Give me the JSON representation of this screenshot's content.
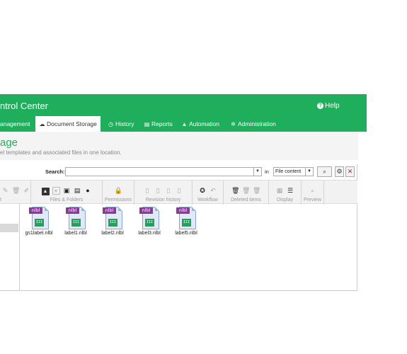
{
  "header": {
    "app_title": "ntrol Center",
    "help_label": "Help",
    "tabs": [
      {
        "label": "anagement",
        "icon": ""
      },
      {
        "label": "Document Storage",
        "icon": "cloud-icon"
      },
      {
        "label": "History",
        "icon": "clock-icon"
      },
      {
        "label": "Reports",
        "icon": "chart-icon"
      },
      {
        "label": "Automation",
        "icon": "robot-icon"
      },
      {
        "label": "Administration",
        "icon": "gears-icon"
      }
    ],
    "active_tab": "Document Storage"
  },
  "subheader": {
    "title": "age",
    "description": "el templates and associated files in one location."
  },
  "search": {
    "label": "Search:",
    "value": "",
    "in_label": "in",
    "scope": "File content"
  },
  "toolbar": {
    "groups": [
      {
        "label": "t",
        "icons": [
          "edit-icon",
          "delete-icon",
          "rename-icon"
        ]
      },
      {
        "label": "Files & Folders",
        "icons": [
          "upload-icon",
          "download-icon",
          "new-folder-icon",
          "new-file-icon",
          "info-icon"
        ]
      },
      {
        "label": "Permissions",
        "icons": [
          "lock-icon"
        ]
      },
      {
        "label": "Revision history",
        "icons": [
          "checkout-icon",
          "checkin-icon",
          "undo-checkout-icon",
          "history-icon"
        ]
      },
      {
        "label": "Workflow",
        "icons": [
          "workflow-icon",
          "workflow-undo-icon"
        ]
      },
      {
        "label": "Deleted items",
        "icons": [
          "recycle-bin-icon",
          "restore-icon",
          "purge-icon"
        ]
      },
      {
        "label": "Display",
        "icons": [
          "grid-view-icon",
          "list-view-icon"
        ]
      },
      {
        "label": "Preview",
        "icons": [
          "preview-icon"
        ]
      }
    ]
  },
  "files": [
    {
      "name": "gs1label.nlbl",
      "type_tag": "nlbl",
      "badge": "III"
    },
    {
      "name": "label1.nlbl",
      "type_tag": "nlbl",
      "badge": "III"
    },
    {
      "name": "label2.nlbl",
      "type_tag": "nlbl",
      "badge": "III"
    },
    {
      "name": "label3.nlbl",
      "type_tag": "nlbl",
      "badge": "III"
    },
    {
      "name": "label5.nlbl",
      "type_tag": "nlbl",
      "badge": "III"
    }
  ],
  "colors": {
    "brand_green": "#1fae5c",
    "nlbl_tag": "#8a3b96",
    "barcode_badge": "#1fa35a"
  }
}
